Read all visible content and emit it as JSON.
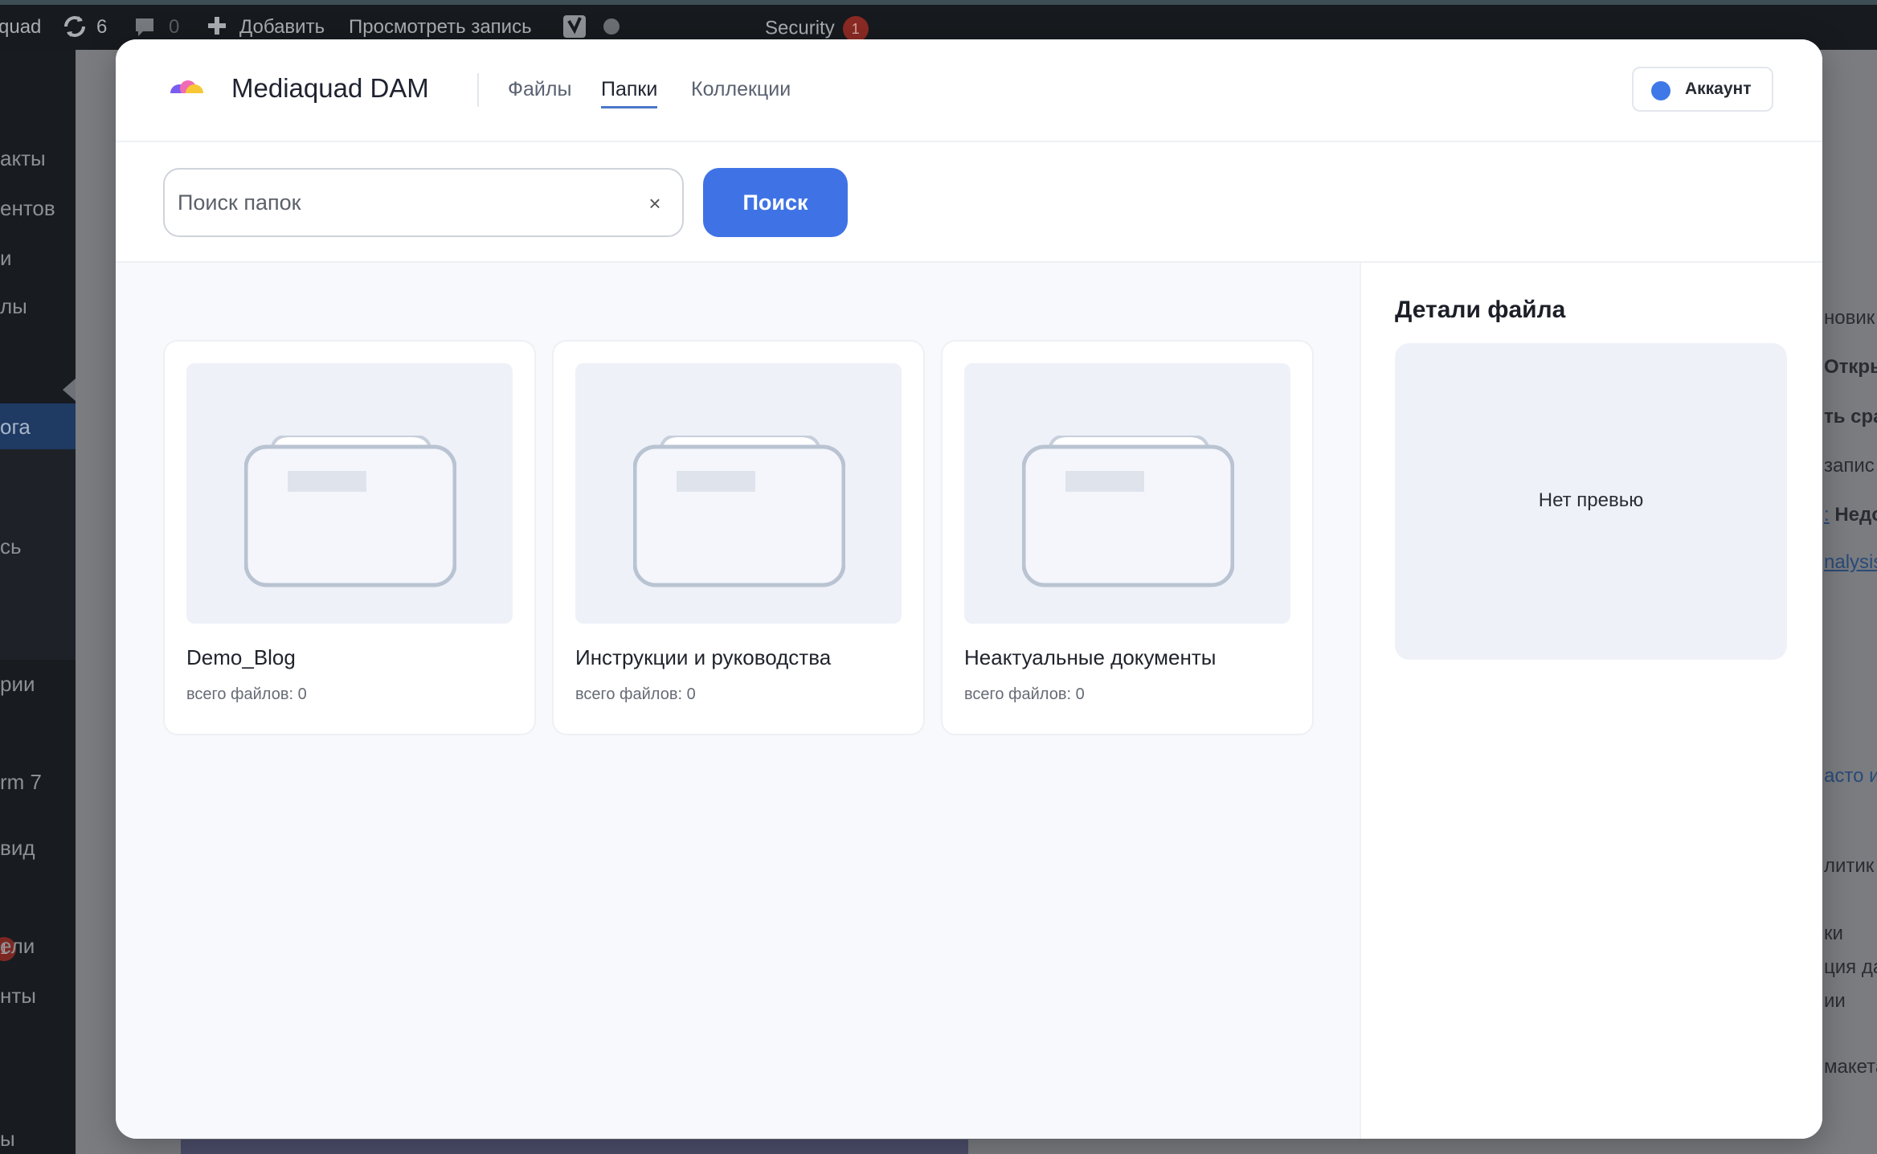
{
  "wp_adminbar": {
    "site_name": "quad",
    "updates_count": "6",
    "comments_count": "0",
    "add_new": "Добавить",
    "view_post": "Просмотреть запись",
    "security_label": "Security",
    "security_count": "1"
  },
  "wp_sidebar": {
    "items": [
      "акты",
      "ентов",
      "и",
      "лы",
      "ога",
      "сь",
      "рии",
      "rm 7",
      "вид",
      "ели",
      "нты",
      "ы"
    ],
    "badge": "1"
  },
  "wp_right": {
    "lines": [
      "новик",
      "Откры",
      "ть сра",
      "запис",
      "Недо",
      "nalysis",
      "асто и",
      "литик",
      "ки",
      "ция да",
      "ии",
      "макета"
    ],
    "link_prefix": ":"
  },
  "app": {
    "title": "Mediaquad DAM",
    "tabs": [
      {
        "label": "Файлы",
        "active": false
      },
      {
        "label": "Папки",
        "active": true
      },
      {
        "label": "Коллекции",
        "active": false
      }
    ],
    "account_label": "Аккаунт",
    "account_dot_color": "#3f79e8"
  },
  "search": {
    "placeholder": "Поиск папок",
    "value": "",
    "clear_icon": "×",
    "button_label": "Поиск",
    "button_color": "#3f73e5"
  },
  "folders": [
    {
      "name": "Demo_Blog",
      "count_text": "всего файлов: 0"
    },
    {
      "name": "Инструкции и руководства",
      "count_text": "всего файлов: 0"
    },
    {
      "name": "Неактуальные документы",
      "count_text": "всего файлов: 0"
    }
  ],
  "details": {
    "title": "Детали файла",
    "no_preview": "Нет превью"
  }
}
